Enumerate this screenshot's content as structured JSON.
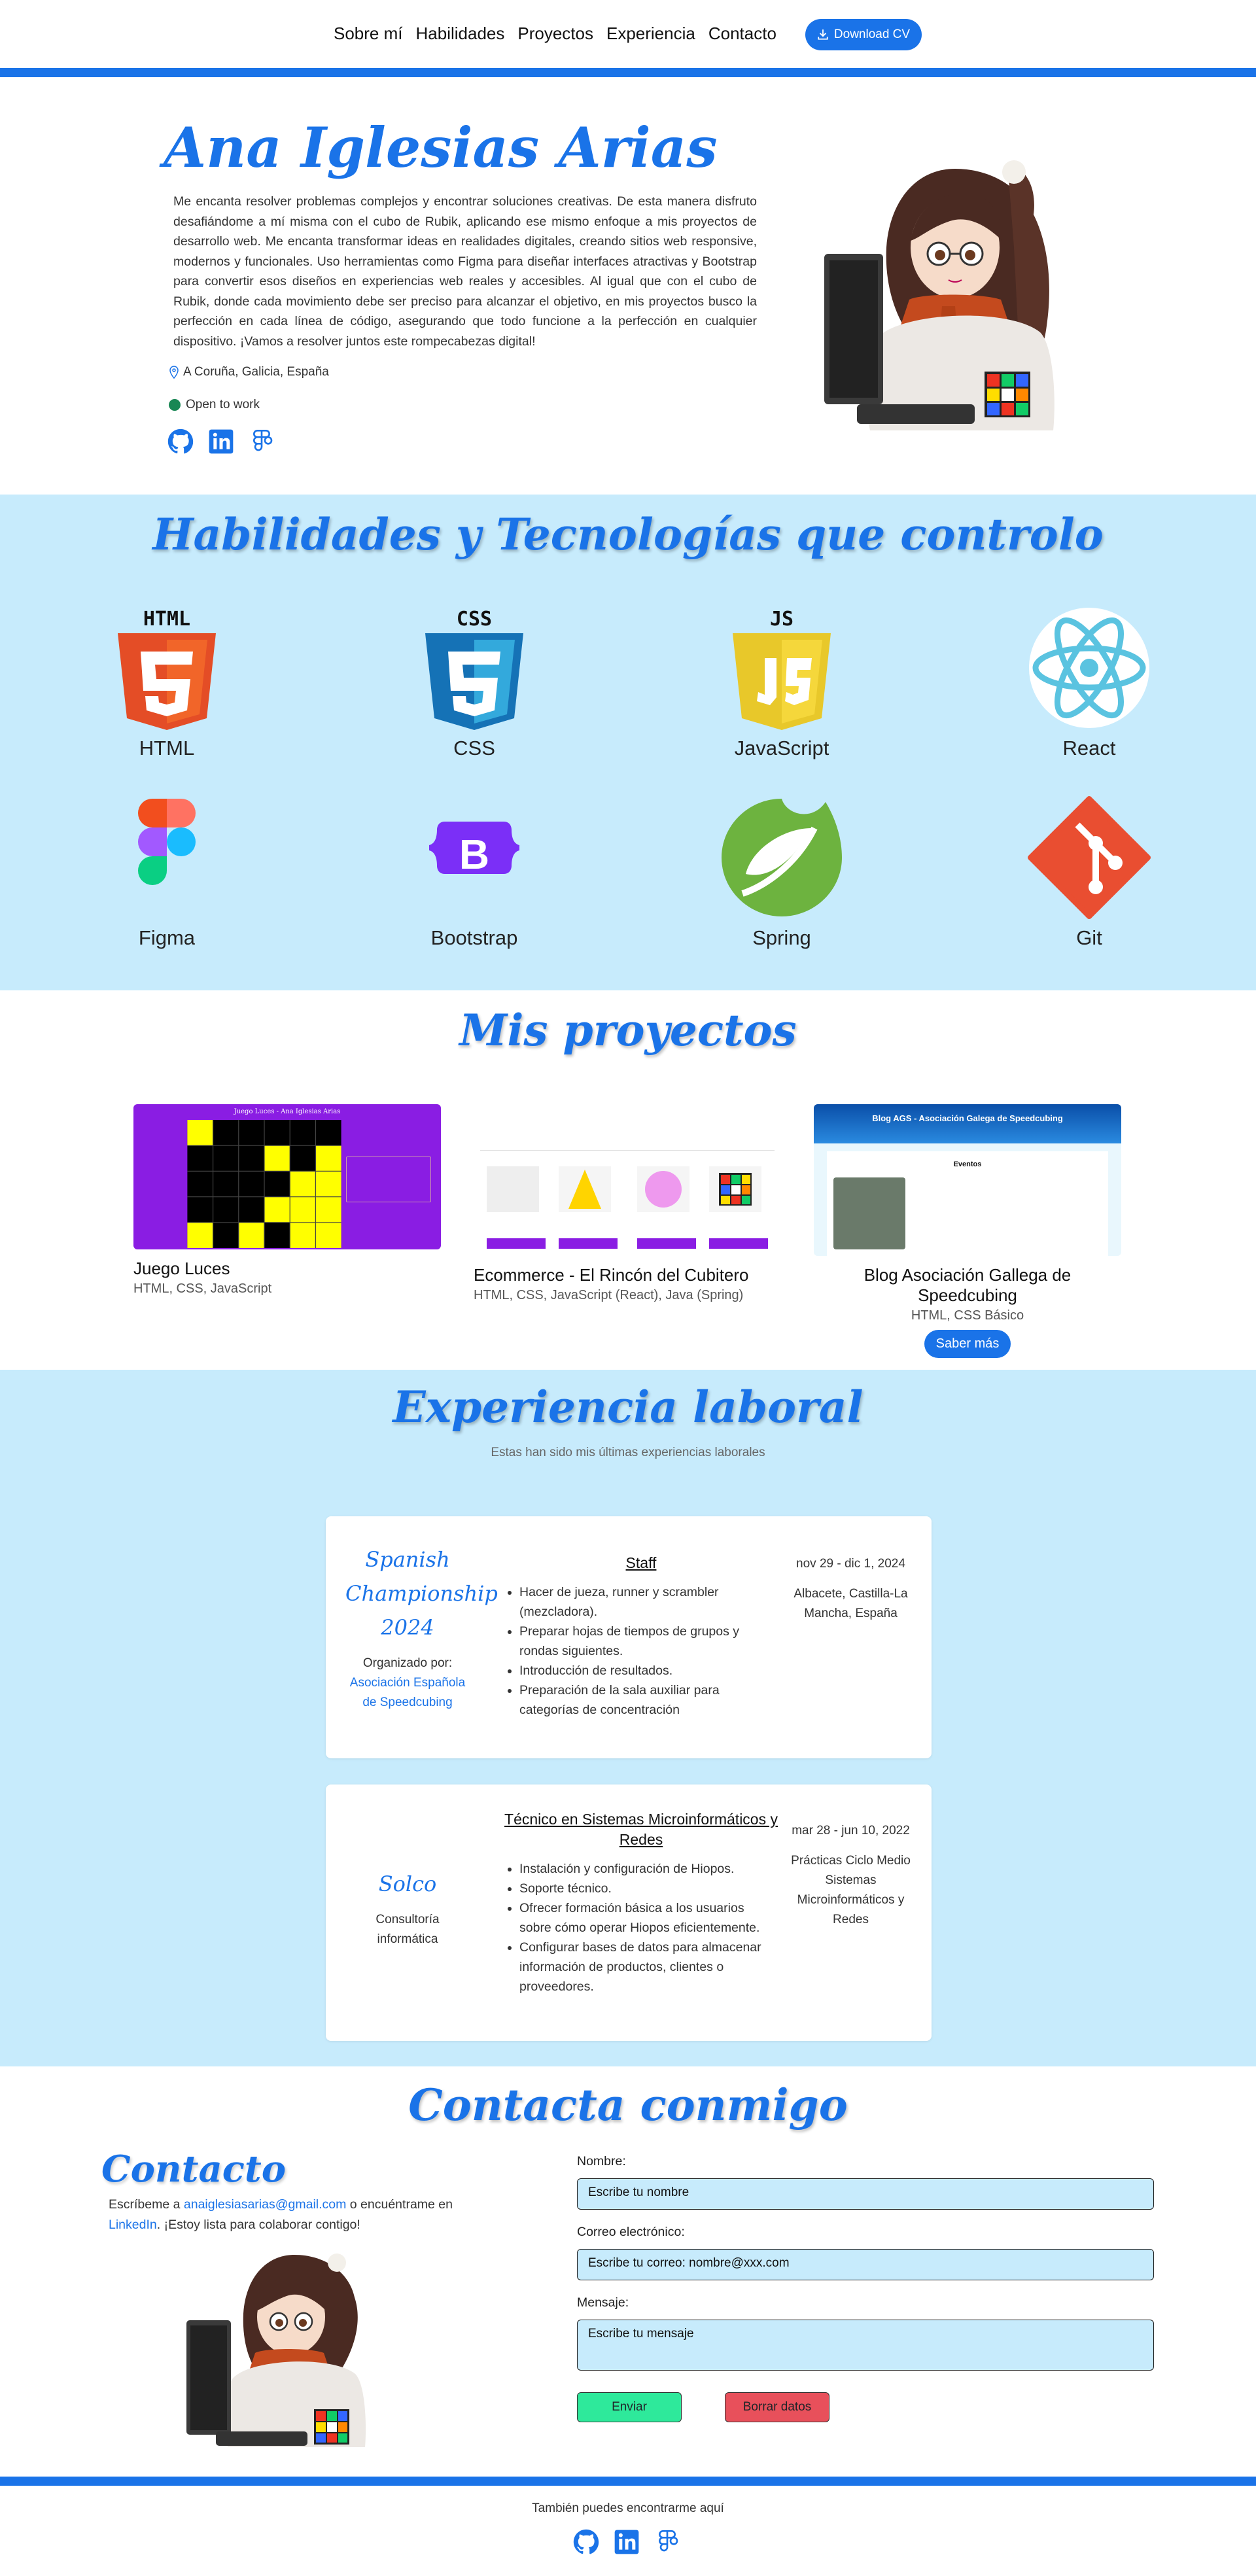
{
  "nav": {
    "links": [
      "Sobre mí",
      "Habilidades",
      "Proyectos",
      "Experiencia",
      "Contacto"
    ],
    "cv_label": "Download CV"
  },
  "hero": {
    "name": "Ana Iglesias Arias",
    "bio": "Me encanta resolver problemas complejos y encontrar soluciones creativas. De esta manera disfruto desafiándome a mí misma con el cubo de Rubik, aplicando ese mismo enfoque a mis proyectos de desarrollo web. Me encanta transformar ideas en realidades digitales, creando sitios web responsive, modernos y funcionales. Uso herramientas como Figma para diseñar interfaces atractivas y Bootstrap para convertir esos diseños en experiencias web reales y accesibles. Al igual que con el cubo de Rubik, donde cada movimiento debe ser preciso para alcanzar el objetivo, en mis proyectos busco la perfección en cada línea de código, asegurando que todo funcione a la perfección en cualquier dispositivo. ¡Vamos a resolver juntos este rompecabezas digital!",
    "location": "A Coruña, Galicia, España",
    "status": "Open to work"
  },
  "skills": {
    "title": "Habilidades y Tecnologías que controlo",
    "items": [
      {
        "label": "HTML",
        "icon": "html5-icon"
      },
      {
        "label": "CSS",
        "icon": "css3-icon"
      },
      {
        "label": "JavaScript",
        "icon": "javascript-icon"
      },
      {
        "label": "React",
        "icon": "react-icon"
      },
      {
        "label": "Figma",
        "icon": "figma-icon"
      },
      {
        "label": "Bootstrap",
        "icon": "bootstrap-icon"
      },
      {
        "label": "Spring",
        "icon": "spring-icon"
      },
      {
        "label": "Git",
        "icon": "git-icon"
      }
    ]
  },
  "projects": {
    "title": "Mis proyectos",
    "items": [
      {
        "title": "Juego Luces",
        "tech": "HTML, CSS, JavaScript"
      },
      {
        "title": "Ecommerce - El Rincón del Cubitero",
        "tech": "HTML, CSS, JavaScript (React), Java (Spring)"
      },
      {
        "title": "Blog Asociación Gallega de Speedcubing",
        "tech": "HTML, CSS Básico",
        "button": "Saber más"
      }
    ],
    "thumb1": {
      "header": "Juego Luces - Ana Iglesias Arias"
    },
    "thumb3": {
      "header": "Blog AGS - Asociación Galega de Speedcubing",
      "section": "Eventos"
    }
  },
  "experience": {
    "title": "Experiencia laboral",
    "subtitle": "Estas han sido mis últimas experiencias laborales",
    "jobs": [
      {
        "org": "Spanish Championship 2024",
        "org_label": "Organizado por:",
        "org_link": "Asociación Española de Speedcubing",
        "role": "Staff",
        "tasks": [
          "Hacer de jueza, runner y scrambler (mezcladora).",
          "Preparar hojas de tiempos de grupos y rondas siguientes.",
          "Introducción de resultados.",
          "Preparación de la sala auxiliar para categorías de concentración"
        ],
        "date": "nov 29 - dic 1, 2024",
        "place": "Albacete, Castilla-La Mancha, España"
      },
      {
        "org": "Solco",
        "org_label": "Consultoría informática",
        "role": "Técnico en Sistemas Microinformáticos y Redes",
        "tasks": [
          "Instalación y configuración de Hiopos.",
          "Soporte técnico.",
          "Ofrecer formación básica a los usuarios sobre cómo operar Hiopos eficientemente.",
          "Configurar bases de datos para almacenar información de productos, clientes o proveedores."
        ],
        "date": "mar 28 - jun 10, 2022",
        "place": "Prácticas Ciclo Medio Sistemas Microinformáticos y Redes"
      }
    ]
  },
  "contact": {
    "title": "Contacta conmigo",
    "subtitle": "Contacto",
    "text_before": "Escríbeme a ",
    "email": "anaiglesiasarias@gmail.com",
    "text_mid": " o encuéntrame en ",
    "linkedin": "LinkedIn",
    "text_after": ". ¡Estoy lista para colaborar contigo!",
    "form": {
      "name_label": "Nombre:",
      "name_placeholder": "Escribe tu nombre",
      "email_label": "Correo electrónico:",
      "email_placeholder": "Escribe tu correo: nombre@xxx.com",
      "message_label": "Mensaje:",
      "message_placeholder": "Escribe tu mensaje",
      "send": "Enviar",
      "clear": "Borrar datos"
    }
  },
  "footer": {
    "text": "También puedes encontrarme aquí"
  },
  "colors": {
    "primary": "#1a73e8",
    "section_bg": "#c7ebfc",
    "send": "#2ee99b",
    "clear": "#e8505b"
  }
}
